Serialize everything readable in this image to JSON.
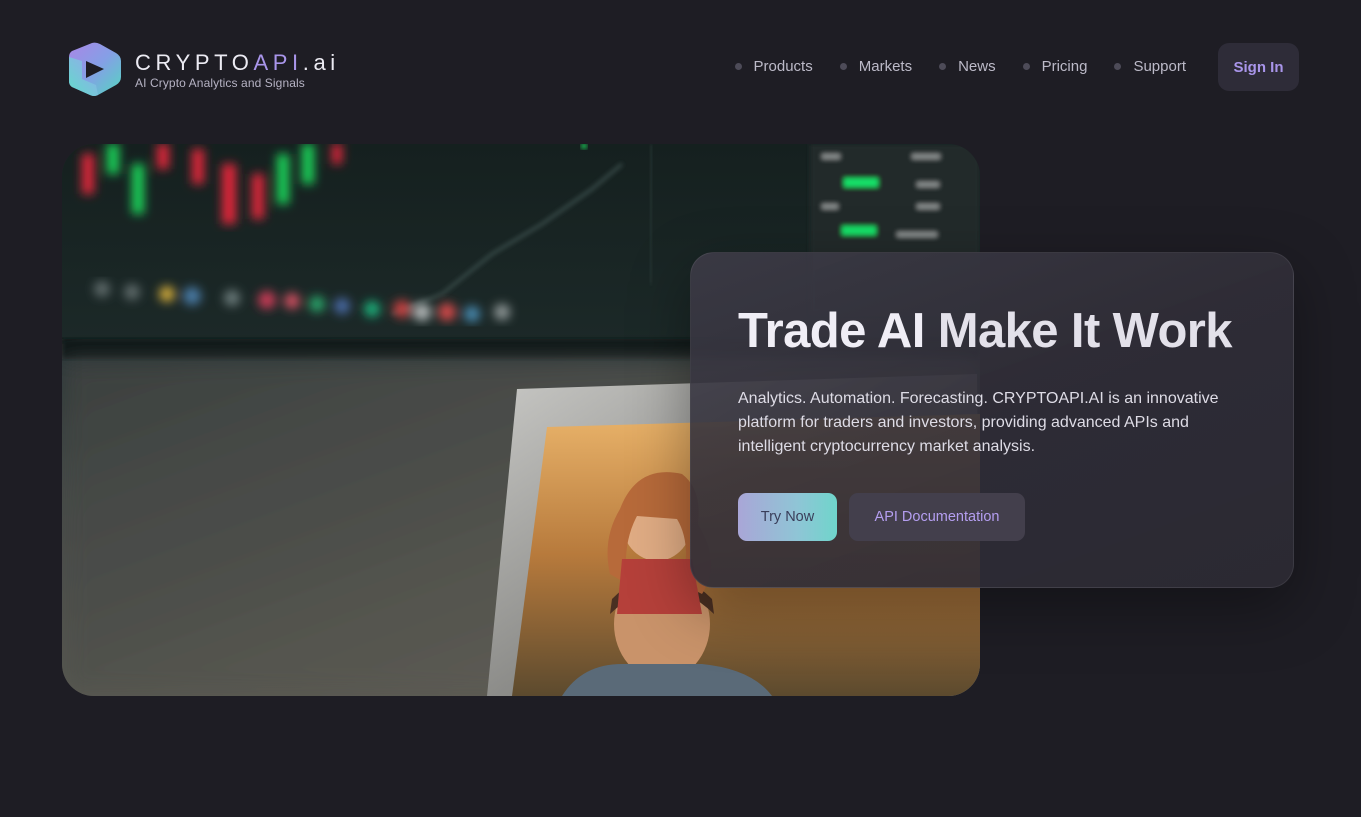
{
  "brand": {
    "name_part1": "CRYPTO",
    "name_part2": "API",
    "name_part3": ".ai",
    "tagline": "AI Crypto Analytics and Signals"
  },
  "nav": {
    "items": [
      {
        "label": "Products"
      },
      {
        "label": "Markets"
      },
      {
        "label": "News"
      },
      {
        "label": "Pricing"
      },
      {
        "label": "Support"
      }
    ],
    "signin_label": "Sign In"
  },
  "hero": {
    "headline_strong": "Trade AI",
    "headline_light": "Make It Work",
    "description": "Analytics. Automation. Forecasting. CRYPTOAPI.AI is an innovative platform for traders and investors, providing advanced APIs and intelligent cryptocurrency market analysis.",
    "primary_button": "Try Now",
    "secondary_button": "API Documentation"
  },
  "colors": {
    "background": "#1e1d24",
    "accent": "#a995ea",
    "card": "#302e38"
  }
}
